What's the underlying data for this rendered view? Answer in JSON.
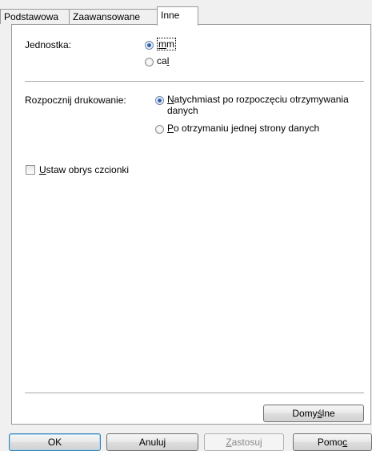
{
  "tabs": [
    {
      "label": "Podstawowa"
    },
    {
      "label": "Zaawansowane"
    },
    {
      "label": "Inne"
    }
  ],
  "unit": {
    "label": "Jednostka:",
    "options": [
      {
        "label_pre": "",
        "accel": "m",
        "label_post": "m",
        "selected": true
      },
      {
        "label_pre": "ca",
        "accel": "l",
        "label_post": "",
        "selected": false
      }
    ]
  },
  "start_print": {
    "label": "Rozpocznij drukowanie:",
    "options": [
      {
        "accel": "N",
        "label_post": "atychmiast po rozpoczęciu otrzymywania",
        "line2": "danych",
        "selected": true
      },
      {
        "accel": "P",
        "label_post": "o otrzymaniu jednej strony danych",
        "selected": false
      }
    ]
  },
  "font_outline": {
    "accel": "U",
    "label_post": "staw obrys czcionki",
    "checked": false
  },
  "defaults_button": {
    "label_pre": "Domy",
    "accel": "ś",
    "label_post": "lne"
  },
  "footer": {
    "ok": "OK",
    "cancel": "Anuluj",
    "apply_accel": "Z",
    "apply_post": "astosuj",
    "help_pre": "Pomo",
    "help_accel": "c"
  }
}
